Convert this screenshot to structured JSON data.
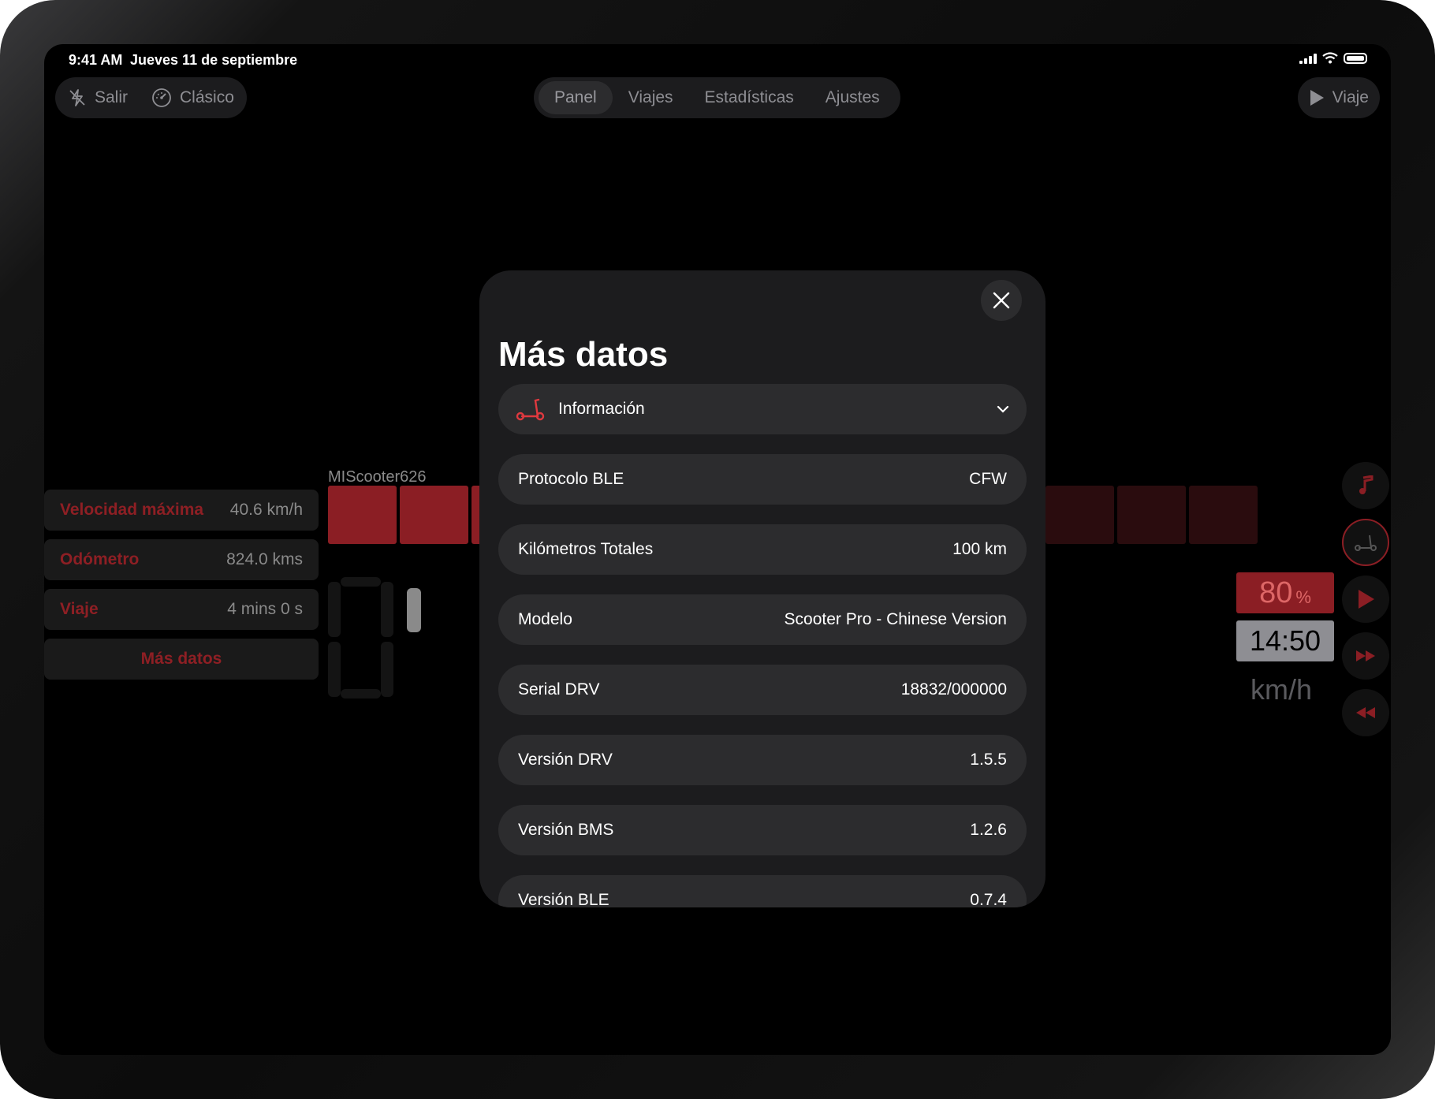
{
  "status_bar": {
    "time": "9:41 AM",
    "date": "Jueves 11 de septiembre"
  },
  "toolbar": {
    "exit_label": "Salir",
    "classic_label": "Clásico",
    "tabs": [
      {
        "label": "Panel",
        "active": true
      },
      {
        "label": "Viajes",
        "active": false
      },
      {
        "label": "Estadísticas",
        "active": false
      },
      {
        "label": "Ajustes",
        "active": false
      }
    ],
    "trip_label": "Viaje"
  },
  "dashboard": {
    "device_name": "MIScooter626",
    "stats": [
      {
        "label": "Velocidad máxima",
        "value": "40.6 km/h"
      },
      {
        "label": "Odómetro",
        "value": "824.0 kms"
      },
      {
        "label": "Viaje",
        "value": "4 mins 0 s"
      }
    ],
    "more_data_button": "Más datos",
    "battery_value": "80",
    "battery_unit": "%",
    "time_remaining": "14:50",
    "speed_unit": "km/h",
    "colors": {
      "accent": "#8e1f24",
      "bar_on": "#8b1e24",
      "bar_off": "#2a0c0e"
    }
  },
  "modal": {
    "title": "Más datos",
    "dropdown": {
      "icon": "scooter-icon",
      "selected": "Información"
    },
    "rows": [
      {
        "label": "Protocolo BLE",
        "value": "CFW"
      },
      {
        "label": "Kilómetros Totales",
        "value": "100 km"
      },
      {
        "label": "Modelo",
        "value": "Scooter Pro - Chinese Version"
      },
      {
        "label": "Serial DRV",
        "value": "18832/000000"
      },
      {
        "label": "Versión DRV",
        "value": "1.5.5"
      },
      {
        "label": "Versión BMS",
        "value": "1.2.6"
      },
      {
        "label": "Versión BLE",
        "value": "0.7.4"
      }
    ]
  }
}
